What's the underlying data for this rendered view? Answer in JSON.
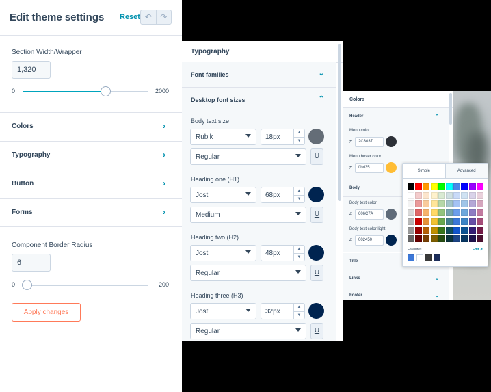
{
  "theme": {
    "title": "Edit theme settings",
    "reset": "Reset",
    "undo_icon": "↶",
    "redo_icon": "↷",
    "section_width": {
      "label": "Section Width/Wrapper",
      "value": "1,320",
      "min": "0",
      "max": "2000",
      "fraction": 0.66
    },
    "sections": [
      {
        "label": "Colors",
        "chevron": "›"
      },
      {
        "label": "Typography",
        "chevron": "›"
      },
      {
        "label": "Button",
        "chevron": "›"
      },
      {
        "label": "Forms",
        "chevron": "›"
      }
    ],
    "border_radius": {
      "label": "Component Border Radius",
      "value": "6",
      "min": "0",
      "max": "200",
      "fraction": 0.03
    },
    "apply": "Apply changes"
  },
  "typography": {
    "title": "Typography",
    "rows": [
      {
        "label": "Font families",
        "chevron": "⌄"
      },
      {
        "label": "Desktop font sizes",
        "chevron": "⌃"
      }
    ],
    "sizes": [
      {
        "label": "Body text size",
        "font": "Rubik",
        "size": "18px",
        "weight": "Regular",
        "color": "#646d77"
      },
      {
        "label": "Heading one (H1)",
        "font": "Jost",
        "size": "68px",
        "weight": "Medium",
        "color": "#002450"
      },
      {
        "label": "Heading two (H2)",
        "font": "Jost",
        "size": "48px",
        "weight": "Regular",
        "color": "#002450"
      },
      {
        "label": "Heading three (H3)",
        "font": "Jost",
        "size": "32px",
        "weight": "Regular",
        "color": "#002450"
      }
    ],
    "underline": "U",
    "step_up": "▲",
    "step_down": "▼"
  },
  "colors": {
    "title": "Colors",
    "header_label": "Header",
    "header_chevron": "⌃",
    "hash": "#",
    "header_fields": [
      {
        "label": "Menu color",
        "value": "2C3037",
        "color": "#2c3037"
      },
      {
        "label": "Menu hover color",
        "value": "ffbd35",
        "color": "#ffbd35"
      }
    ],
    "body_label": "Body",
    "body_fields": [
      {
        "label": "Body text color",
        "value": "606C7A",
        "color": "#606c7a"
      },
      {
        "label": "Body text color light",
        "value": "002450",
        "color": "#002450"
      }
    ],
    "other_rows": [
      {
        "label": "Title",
        "chevron": ""
      },
      {
        "label": "Links",
        "chevron": "⌄"
      },
      {
        "label": "Footer",
        "chevron": "⌄"
      }
    ]
  },
  "picker": {
    "tab_simple": "Simple",
    "tab_advanced": "Advanced",
    "favorites_label": "Favorites",
    "edit_label": "Edit ⇗",
    "palette": [
      [
        "#000000",
        "#ff0000",
        "#ff9900",
        "#ffff00",
        "#00ff00",
        "#00ffff",
        "#4a86e8",
        "#0000ff",
        "#9900ff",
        "#ff00ff"
      ],
      [
        "#ffffff",
        "#f4cccc",
        "#fce5cd",
        "#fff2cc",
        "#d9ead3",
        "#d0e0e3",
        "#c9daf8",
        "#cfe2f3",
        "#d9d2e9",
        "#ead1dc"
      ],
      [
        "#f3f3f3",
        "#ea9999",
        "#f9cb9c",
        "#ffe599",
        "#b6d7a8",
        "#a2c4c9",
        "#a4c2f4",
        "#9fc5e8",
        "#b4a7d6",
        "#d5a6bd"
      ],
      [
        "#d9d9d9",
        "#e06666",
        "#f6b26b",
        "#ffd966",
        "#93c47d",
        "#76a5af",
        "#6d9eeb",
        "#6fa8dc",
        "#8e7cc3",
        "#c27ba0"
      ],
      [
        "#b7b7b7",
        "#cc0000",
        "#e69138",
        "#f1c232",
        "#6aa84f",
        "#45818e",
        "#3c78d8",
        "#3d85c6",
        "#674ea7",
        "#a64d79"
      ],
      [
        "#999999",
        "#990000",
        "#b45f06",
        "#bf9000",
        "#38761d",
        "#134f5c",
        "#1155cc",
        "#0b5394",
        "#351c75",
        "#741b47"
      ],
      [
        "#666666",
        "#660000",
        "#783f04",
        "#7f6000",
        "#274e13",
        "#0c343d",
        "#1c4587",
        "#073763",
        "#20124d",
        "#4c1130"
      ]
    ],
    "favorites": [
      "#3c78d8",
      "#ffffff",
      "#3a3a3a",
      "#1c2d5a"
    ]
  }
}
